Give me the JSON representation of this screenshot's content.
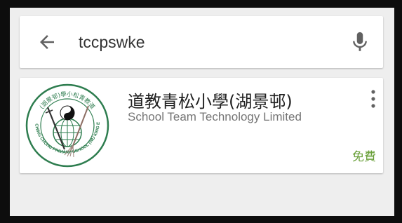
{
  "search": {
    "query": "tccpswke",
    "back_icon": "arrow-back-icon",
    "voice_icon": "microphone-icon"
  },
  "result": {
    "title": "道教青松小學(湖景邨)",
    "developer": "School Team Technology Limited",
    "price": "免費",
    "price_color": "#689f38",
    "more_icon": "more-vert-icon",
    "logo": {
      "top_text": "(湖景邨)學小松青教道",
      "bottom_text": "TAOIST CHING CHUNG PRIMARY SCHOOL (WU KING ESTATE)"
    }
  }
}
